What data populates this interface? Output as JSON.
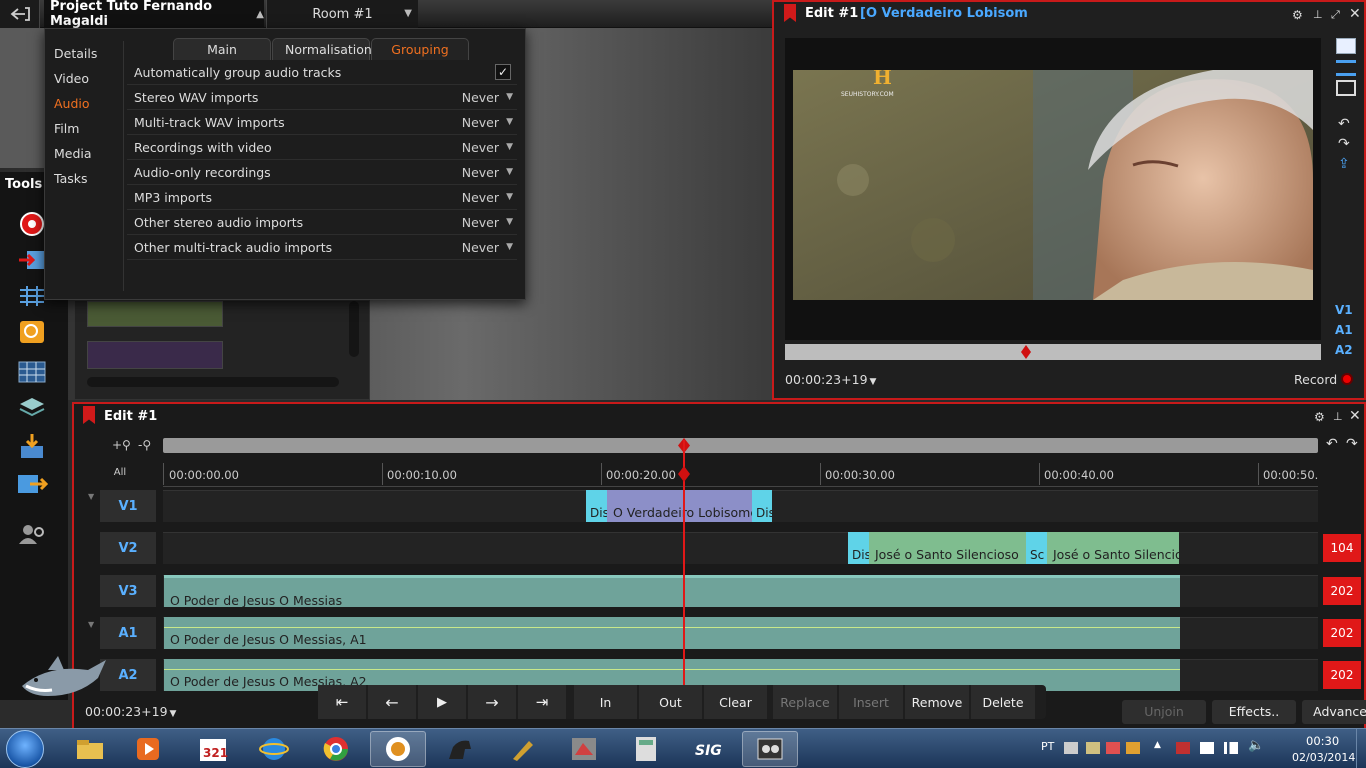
{
  "app": {
    "project_title": "Project Tuto Fernando Magaldi",
    "room": "Room #1",
    "tools_label": "Tools"
  },
  "settings": {
    "nav": [
      "Details",
      "Video",
      "Audio",
      "Film",
      "Media",
      "Tasks"
    ],
    "active_nav": "Audio",
    "tabs": [
      "Main",
      "Normalisation",
      "Grouping"
    ],
    "active_tab": "Grouping",
    "auto_group": {
      "label": "Automatically group audio tracks",
      "checked": true,
      "check_glyph": "✓"
    },
    "rows": [
      {
        "label": "Stereo WAV imports",
        "value": "Never"
      },
      {
        "label": "Multi-track WAV imports",
        "value": "Never"
      },
      {
        "label": "Recordings with video",
        "value": "Never"
      },
      {
        "label": "Audio-only recordings",
        "value": "Never"
      },
      {
        "label": "MP3 imports",
        "value": "Never"
      },
      {
        "label": "Other stereo audio imports",
        "value": "Never"
      },
      {
        "label": "Other multi-track audio imports",
        "value": "Never"
      }
    ]
  },
  "viewer": {
    "title": "Edit #1",
    "clip_name": "[O Verdadeiro Lobisom",
    "timecode": "00:00:23+19",
    "record_label": "Record",
    "tracks": [
      "V1",
      "A1",
      "A2"
    ]
  },
  "timeline": {
    "title": "Edit #1",
    "all_label": "All",
    "ruler": [
      "00:00:00.00",
      "00:00:10.00",
      "00:00:20.00",
      "00:00:30.00",
      "00:00:40.00",
      "00:00:50."
    ],
    "tracks": [
      {
        "name": "V1",
        "count": ""
      },
      {
        "name": "V2",
        "count": "104"
      },
      {
        "name": "V3",
        "count": "202"
      },
      {
        "name": "A1",
        "count": "202"
      },
      {
        "name": "A2",
        "count": "202"
      }
    ],
    "clips": {
      "v1_trans_a": "Dis",
      "v1_main": "O Verdadeiro Lobisomem",
      "v1_trans_b": "Dis",
      "v2_trans_a": "Dis",
      "v2_clip_a": "José o Santo Silencioso",
      "v2_trans_b": "Sc",
      "v2_clip_b": "José o Santo Silencioso",
      "v3_clip": "O Poder de Jesus   O Messias",
      "a1_clip": "O Poder de Jesus   O Messias, A1",
      "a2_clip": "O Poder de Jesus   O Messias, A2"
    },
    "timecode": "00:00:23+19"
  },
  "transport": {
    "in": "In",
    "out": "Out",
    "clear": "Clear",
    "replace": "Replace",
    "insert": "Insert",
    "remove": "Remove",
    "delete": "Delete"
  },
  "actions": {
    "unjoin": "Unjoin",
    "effects": "Effects..",
    "advanced": "Advanced"
  },
  "taskbar": {
    "lang": "PT",
    "time": "00:30",
    "date": "02/03/2014"
  },
  "colors": {
    "accent": "#f07020",
    "record_border": "#c81a1a",
    "track_label": "#5ab0ff"
  }
}
